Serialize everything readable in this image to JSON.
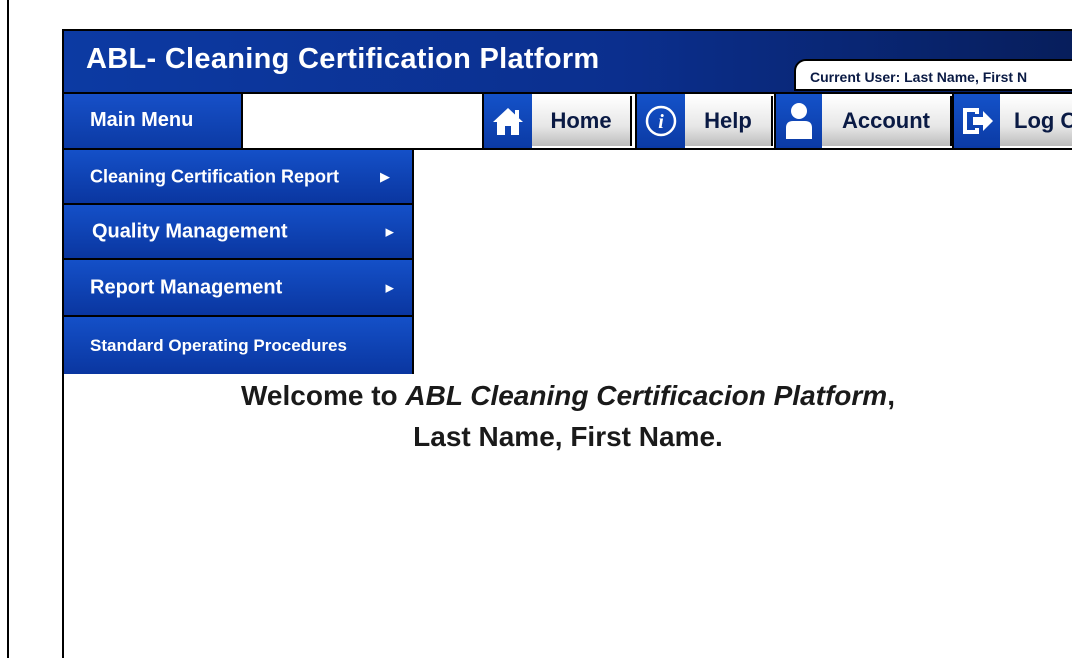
{
  "window": {
    "title": "ABL- Cleaning Certification Platform",
    "current_user": "Current User:  Last Name, First N"
  },
  "nav": {
    "main_menu_label": "Main Menu",
    "search_value": "",
    "items": [
      {
        "label": "Home",
        "icon": "home-icon"
      },
      {
        "label": "Help",
        "icon": "info-icon"
      },
      {
        "label": "Account",
        "icon": "user-icon"
      },
      {
        "label": "Log C",
        "icon": "logout-icon"
      }
    ]
  },
  "submenu": {
    "items": [
      {
        "label": "Cleaning Certification Report",
        "arrow": "▶"
      },
      {
        "label": "Quality Management",
        "arrow": "▶"
      },
      {
        "label": "Report Management",
        "arrow": "▶"
      },
      {
        "label": "Standard Operating Procedures",
        "arrow": ""
      }
    ]
  },
  "welcome": {
    "prefix": "Welcome to ",
    "platform": "ABL Cleaning Certificacion Platform",
    "suffix": ",",
    "name": "Last Name, First Name."
  },
  "colors": {
    "brand_blue": "#0b3aa4",
    "title_gradient_end": "#071e5c",
    "text_dark": "#0a1a44"
  }
}
